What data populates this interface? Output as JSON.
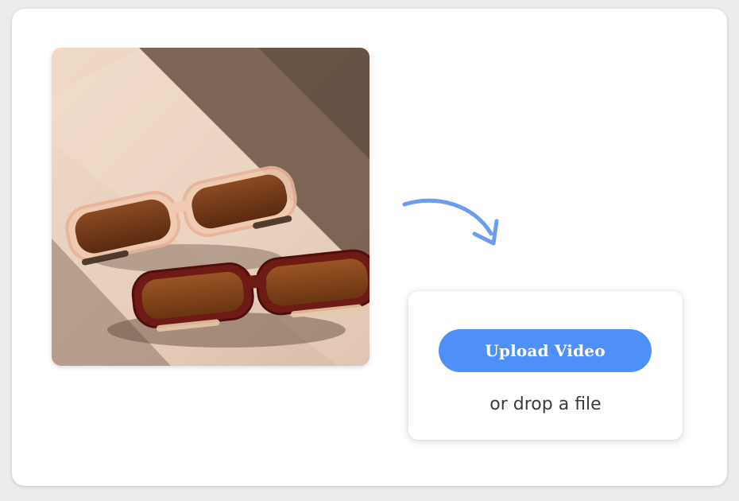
{
  "upload": {
    "button_label": "Upload Video",
    "drop_text": "or drop a file"
  },
  "image": {
    "subject": "two pairs of brown-tinted rectangular sunglasses on a beige surface with diagonal shadow"
  },
  "colors": {
    "accent": "#4e8ff8",
    "arrow": "#6a9cf0",
    "card_bg": "#ffffff",
    "page_bg": "#ececec"
  },
  "icons": {
    "arrow": "curved-arrow-down-right-icon"
  }
}
